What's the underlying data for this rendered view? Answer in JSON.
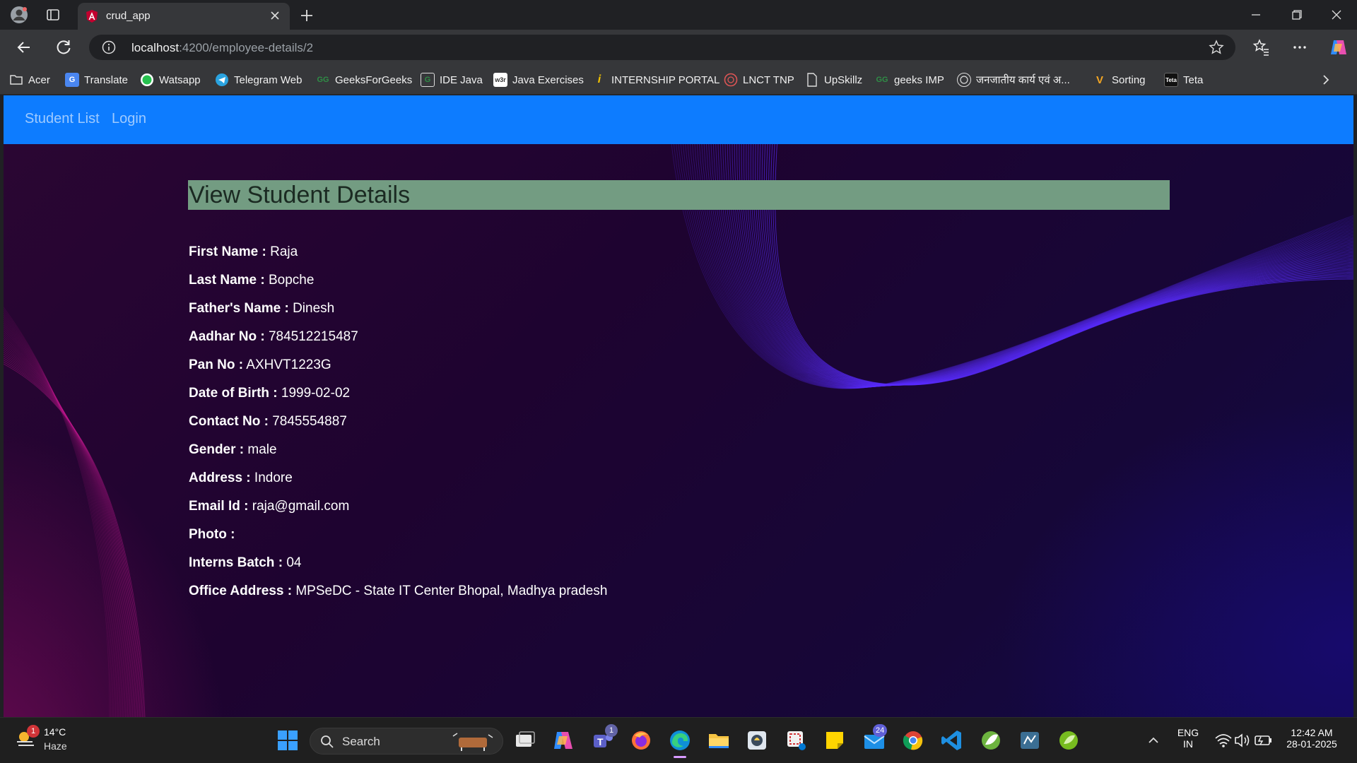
{
  "browser": {
    "tab_title": "crud_app",
    "url_host": "localhost",
    "url_path": ":4200/employee-details/2",
    "bookmarks": [
      {
        "label": "Acer",
        "icon": "folder-icon"
      },
      {
        "label": "Translate",
        "icon": "google-translate-icon"
      },
      {
        "label": "Watsapp",
        "icon": "whatsapp-icon"
      },
      {
        "label": "Telegram Web",
        "icon": "telegram-icon"
      },
      {
        "label": "GeeksForGeeks",
        "icon": "geeksforgeeks-icon"
      },
      {
        "label": "IDE Java",
        "icon": "ide-java-icon"
      },
      {
        "label": "Java Exercises",
        "icon": "w3resource-icon"
      },
      {
        "label": "INTERNSHIP PORTAL",
        "icon": "internship-portal-icon"
      },
      {
        "label": "LNCT TNP",
        "icon": "lnct-icon"
      },
      {
        "label": "UpSkillz",
        "icon": "page-icon"
      },
      {
        "label": "geeks IMP",
        "icon": "geeksforgeeks-icon"
      },
      {
        "label": "जनजातीय कार्य एवं अ...",
        "icon": "mp-govt-icon"
      },
      {
        "label": "Sorting",
        "icon": "sorting-icon"
      },
      {
        "label": "Teta",
        "icon": "teta-icon"
      }
    ]
  },
  "app": {
    "nav": [
      "Student List",
      "Login"
    ],
    "heading": "View Student Details",
    "fields": [
      {
        "label": "First Name :",
        "value": "Raja"
      },
      {
        "label": "Last Name :",
        "value": "Bopche"
      },
      {
        "label": "Father's Name :",
        "value": "Dinesh"
      },
      {
        "label": "Aadhar No :",
        "value": "784512215487"
      },
      {
        "label": "Pan No :",
        "value": "AXHVT1223G"
      },
      {
        "label": "Date of Birth :",
        "value": "1999-02-02"
      },
      {
        "label": "Contact No :",
        "value": "7845554887"
      },
      {
        "label": "Gender :",
        "value": "male"
      },
      {
        "label": "Address :",
        "value": "Indore"
      },
      {
        "label": "Email Id :",
        "value": "raja@gmail.com"
      },
      {
        "label": "Photo :",
        "value": ""
      },
      {
        "label": "Interns Batch :",
        "value": "04"
      },
      {
        "label": "Office Address :",
        "value": "MPSeDC - State IT Center Bhopal, Madhya pradesh"
      }
    ],
    "colors": {
      "navbar": "#0d7cff",
      "heading_bg": "#739c82",
      "wave_lines": "#5a2cff"
    }
  },
  "taskbar": {
    "weather_badge": "1",
    "temperature": "14°C",
    "weather": "Haze",
    "search_label": "Search",
    "teams_badge": "1",
    "mail_badge": "24",
    "lang_top": "ENG",
    "lang_bottom": "IN",
    "time": "12:42 AM",
    "date": "28-01-2025"
  }
}
